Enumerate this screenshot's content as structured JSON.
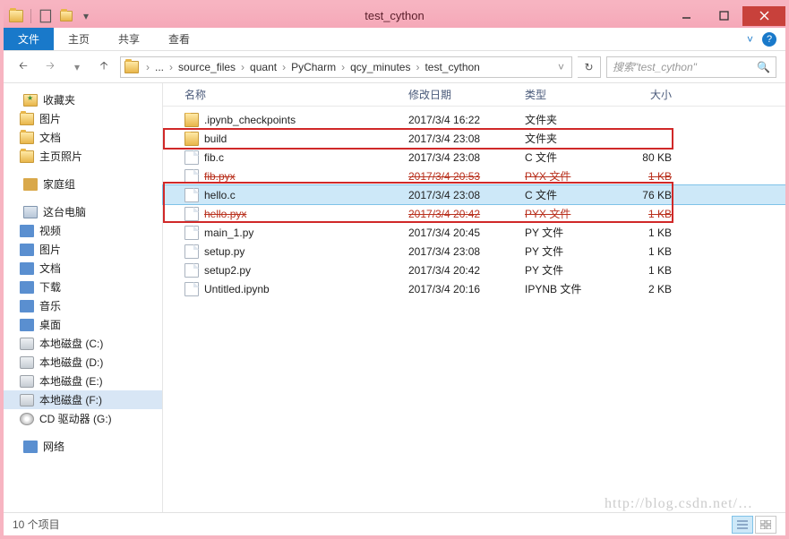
{
  "title": "test_cython",
  "ribbon": {
    "file": "文件",
    "home": "主页",
    "share": "共享",
    "view": "查看"
  },
  "breadcrumb": [
    "source_files",
    "quant",
    "PyCharm",
    "qcy_minutes",
    "test_cython"
  ],
  "search_placeholder": "搜索\"test_cython\"",
  "columns": {
    "name": "名称",
    "date": "修改日期",
    "type": "类型",
    "size": "大小"
  },
  "sidebar": {
    "favorites": {
      "label": "收藏夹",
      "items": [
        "图片",
        "文档",
        "主页照片"
      ]
    },
    "homegroup": "家庭组",
    "thispc": {
      "label": "这台电脑",
      "items": [
        "视频",
        "图片",
        "文档",
        "下载",
        "音乐",
        "桌面",
        "本地磁盘 (C:)",
        "本地磁盘 (D:)",
        "本地磁盘 (E:)",
        "本地磁盘 (F:)",
        "CD 驱动器 (G:)"
      ]
    },
    "network": "网络"
  },
  "files": [
    {
      "name": ".ipynb_checkpoints",
      "date": "2017/3/4 16:22",
      "type": "文件夹",
      "size": "",
      "icon": "folder"
    },
    {
      "name": "build",
      "date": "2017/3/4 23:08",
      "type": "文件夹",
      "size": "",
      "icon": "folder"
    },
    {
      "name": "fib.c",
      "date": "2017/3/4 23:08",
      "type": "C 文件",
      "size": "80 KB",
      "icon": "file"
    },
    {
      "name": "fib.pyx",
      "date": "2017/3/4 20:53",
      "type": "PYX 文件",
      "size": "1 KB",
      "icon": "file",
      "strike": true
    },
    {
      "name": "hello.c",
      "date": "2017/3/4 23:08",
      "type": "C 文件",
      "size": "76 KB",
      "icon": "file",
      "selected": true
    },
    {
      "name": "hello.pyx",
      "date": "2017/3/4 20:42",
      "type": "PYX 文件",
      "size": "1 KB",
      "icon": "file",
      "strike": true
    },
    {
      "name": "main_1.py",
      "date": "2017/3/4 20:45",
      "type": "PY 文件",
      "size": "1 KB",
      "icon": "file"
    },
    {
      "name": "setup.py",
      "date": "2017/3/4 23:08",
      "type": "PY 文件",
      "size": "1 KB",
      "icon": "file"
    },
    {
      "name": "setup2.py",
      "date": "2017/3/4 20:42",
      "type": "PY 文件",
      "size": "1 KB",
      "icon": "file"
    },
    {
      "name": "Untitled.ipynb",
      "date": "2017/3/4 20:16",
      "type": "IPYNB 文件",
      "size": "2 KB",
      "icon": "file"
    }
  ],
  "status": "10 个项目",
  "watermark": "http://blog.csdn.net/…"
}
